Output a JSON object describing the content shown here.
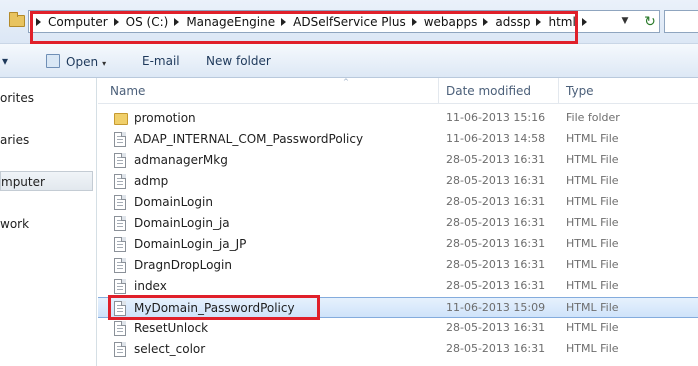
{
  "address": {
    "breadcrumbs": [
      "Computer",
      "OS (C:)",
      "ManageEngine",
      "ADSelfService Plus",
      "webapps",
      "adssp",
      "html"
    ],
    "dropdown_glyph": "▼",
    "refresh_glyph": "↻"
  },
  "toolbar": {
    "organize_arrow": "▾",
    "open_label": "Open",
    "open_arrow": "▾",
    "email_label": "E-mail",
    "new_folder_label": "New folder"
  },
  "nav": {
    "items": [
      "orites",
      "aries",
      "mputer",
      "work"
    ]
  },
  "columns": {
    "name": "Name",
    "date": "Date modified",
    "type": "Type"
  },
  "files": [
    {
      "name": "promotion",
      "date": "11-06-2013 15:16",
      "type": "File folder",
      "icon": "folder-icon"
    },
    {
      "name": "ADAP_INTERNAL_COM_PasswordPolicy",
      "date": "11-06-2013 14:58",
      "type": "HTML File",
      "icon": "html-file-icon"
    },
    {
      "name": "admanagerMkg",
      "date": "28-05-2013 16:31",
      "type": "HTML File",
      "icon": "html-file-icon"
    },
    {
      "name": "admp",
      "date": "28-05-2013 16:31",
      "type": "HTML File",
      "icon": "html-file-icon"
    },
    {
      "name": "DomainLogin",
      "date": "28-05-2013 16:31",
      "type": "HTML File",
      "icon": "html-file-icon"
    },
    {
      "name": "DomainLogin_ja",
      "date": "28-05-2013 16:31",
      "type": "HTML File",
      "icon": "html-file-icon"
    },
    {
      "name": "DomainLogin_ja_JP",
      "date": "28-05-2013 16:31",
      "type": "HTML File",
      "icon": "html-file-icon"
    },
    {
      "name": "DragnDropLogin",
      "date": "28-05-2013 16:31",
      "type": "HTML File",
      "icon": "html-file-icon"
    },
    {
      "name": "index",
      "date": "28-05-2013 16:31",
      "type": "HTML File",
      "icon": "html-file-icon"
    },
    {
      "name": "MyDomain_PasswordPolicy",
      "date": "11-06-2013 15:09",
      "type": "HTML File",
      "icon": "html-file-icon",
      "selected": true
    },
    {
      "name": "ResetUnlock",
      "date": "28-05-2013 16:31",
      "type": "HTML File",
      "icon": "html-file-icon"
    },
    {
      "name": "select_color",
      "date": "28-05-2013 16:31",
      "type": "HTML File",
      "icon": "html-file-icon"
    }
  ],
  "colors": {
    "highlight_red": "#e0202a",
    "selection_blue": "#cfe3fa"
  }
}
